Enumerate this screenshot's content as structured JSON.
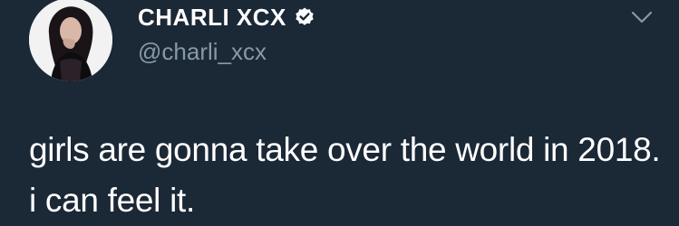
{
  "tweet": {
    "display_name": "CHARLI XCX",
    "verified": true,
    "handle": "@charli_xcx",
    "text": "girls are gonna take over the world in 2018. i can feel it.",
    "avatar_icon": "profile-photo",
    "more_icon": "chevron-down-icon"
  },
  "colors": {
    "background": "#1b2836",
    "text": "#ffffff",
    "secondary_text": "#8899a6",
    "verified_badge": "#ffffff"
  }
}
